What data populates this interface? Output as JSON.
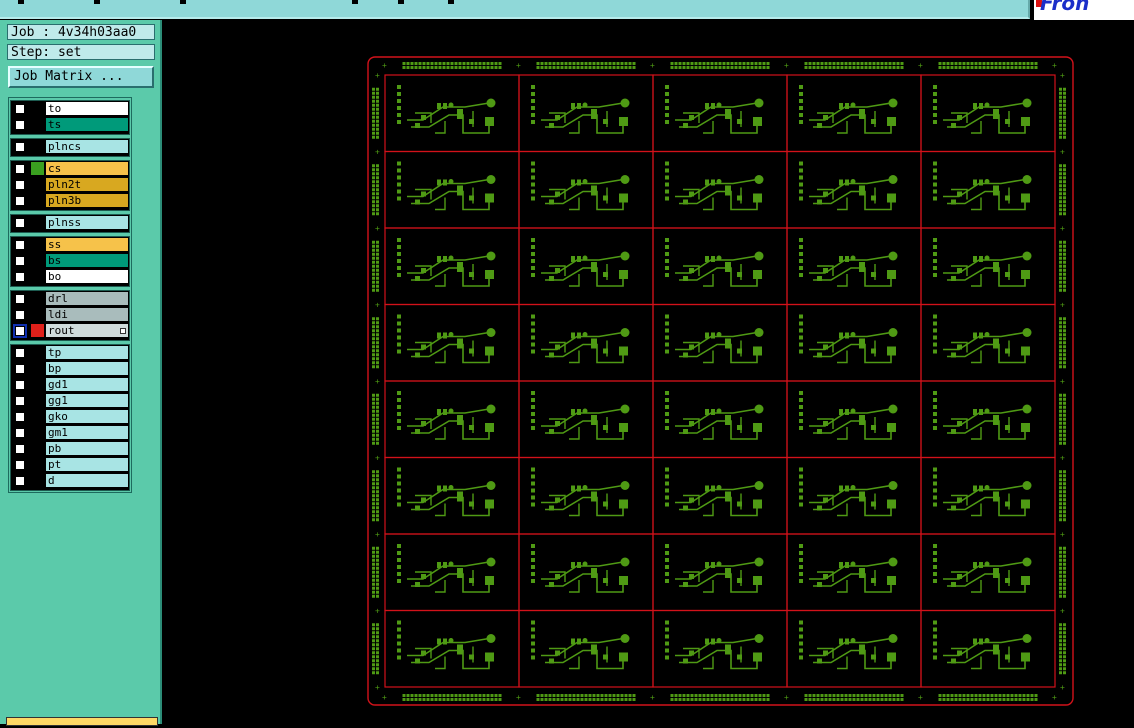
{
  "job_info": {
    "job_label": "Job : 4v34h03aa0",
    "step_label": "Step: set"
  },
  "job_matrix_button": "Job Matrix ...",
  "layer_groups": [
    {
      "layers": [
        {
          "name": "to",
          "color": "#ffffff",
          "swatch": "#000000"
        },
        {
          "name": "ts",
          "color": "#009a7a",
          "swatch": "#000000"
        }
      ]
    },
    {
      "layers": [
        {
          "name": "plncs",
          "color": "#a8e4e4",
          "swatch": "#000000"
        }
      ]
    },
    {
      "layers": [
        {
          "name": "cs",
          "color": "#f6c24a",
          "swatch": "#3aa020"
        },
        {
          "name": "pln2t",
          "color": "#d8a820",
          "swatch": "#000000"
        },
        {
          "name": "pln3b",
          "color": "#d8a820",
          "swatch": "#000000"
        }
      ]
    },
    {
      "layers": [
        {
          "name": "plnss",
          "color": "#a8e4e4",
          "swatch": "#000000"
        }
      ]
    },
    {
      "layers": [
        {
          "name": "ss",
          "color": "#f6c24a",
          "swatch": "#000000"
        },
        {
          "name": "bs",
          "color": "#009a7a",
          "swatch": "#000000"
        },
        {
          "name": "bo",
          "color": "#ffffff",
          "swatch": "#000000"
        }
      ]
    },
    {
      "layers": [
        {
          "name": "drl",
          "color": "#a9bcbc",
          "swatch": "#000000"
        },
        {
          "name": "ldi",
          "color": "#a9bcbc",
          "swatch": "#000000"
        },
        {
          "name": "rout",
          "color": "#d0dcdc",
          "swatch": "#e0201a",
          "active": true
        }
      ]
    },
    {
      "layers": [
        {
          "name": "tp",
          "color": "#a8e4e4",
          "swatch": "#000000"
        },
        {
          "name": "bp",
          "color": "#a8e4e4",
          "swatch": "#000000"
        },
        {
          "name": "gd1",
          "color": "#a8e4e4",
          "swatch": "#000000"
        },
        {
          "name": "gg1",
          "color": "#a8e4e4",
          "swatch": "#000000"
        },
        {
          "name": "gko",
          "color": "#a8e4e4",
          "swatch": "#000000"
        },
        {
          "name": "gm1",
          "color": "#a8e4e4",
          "swatch": "#000000"
        },
        {
          "name": "pb",
          "color": "#a8e4e4",
          "swatch": "#000000"
        },
        {
          "name": "pt",
          "color": "#a8e4e4",
          "swatch": "#000000"
        },
        {
          "name": "d",
          "color": "#a8e4e4",
          "swatch": "#000000"
        }
      ]
    }
  ],
  "panel_array": {
    "columns": 5,
    "rows": 8
  },
  "colors": {
    "panel_bg": "#5bcaaa",
    "board_outline": "#d2121a",
    "copper": "#4f9a14",
    "canvas_bg": "#000000"
  },
  "logo": {
    "name": "frontline-logo"
  }
}
